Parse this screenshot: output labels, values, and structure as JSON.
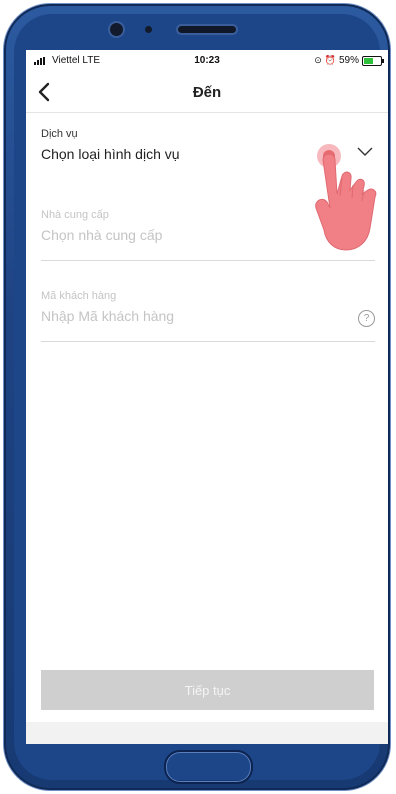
{
  "status_bar": {
    "carrier": "Viettel  LTE",
    "time": "10:23",
    "battery": "59%",
    "icons": [
      "signal-icon",
      "lock-rotation-icon",
      "alarm-icon",
      "battery-icon"
    ]
  },
  "nav": {
    "back_icon": "chevron-left-icon",
    "title": "Đến"
  },
  "form": {
    "service": {
      "label": "Dịch vụ",
      "value": "Chọn loại hình dịch vụ",
      "icon": "chevron-down-icon"
    },
    "provider": {
      "label": "Nhà cung cấp",
      "placeholder": "Chọn nhà cung cấp"
    },
    "customer_code": {
      "label": "Mã khách hàng",
      "placeholder": "Nhập Mã khách hàng",
      "help_symbol": "?"
    }
  },
  "continue_button": {
    "label": "Tiếp tục"
  },
  "colors": {
    "phone_frame": "#1e4383",
    "button_disabled": "#cfcfcf",
    "muted_text": "#c4c4c4",
    "hand": "#f07f86"
  }
}
